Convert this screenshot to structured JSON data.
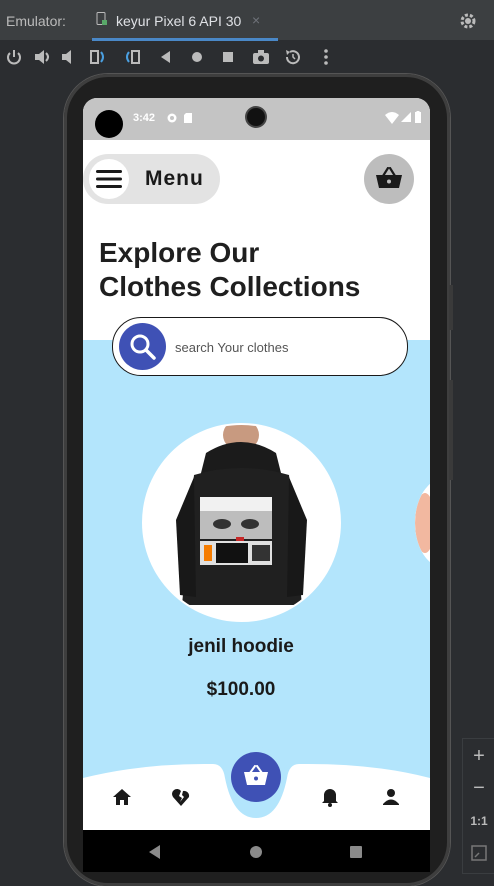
{
  "emulator": {
    "title": "Emulator:",
    "tab_label": "keyur Pixel 6 API 30",
    "tab_close": "×",
    "zoom": {
      "plus": "+",
      "minus": "−",
      "one_to_one": "1:1"
    }
  },
  "status_bar": {
    "time": "3:42"
  },
  "app": {
    "menu_label": "Menu",
    "headline_line1": "Explore Our",
    "headline_line2": "Clothes Collections",
    "search_placeholder": "search Your clothes",
    "product": {
      "name": "jenil hoodie",
      "price": "$100.00"
    },
    "colors": {
      "accent": "#3f51b5",
      "background_blue": "#b3e5fc"
    }
  },
  "icons": [
    "gear-icon",
    "power-icon",
    "volume-up-icon",
    "volume-down-icon",
    "rotate-left-icon",
    "rotate-right-icon",
    "back-icon",
    "home-icon",
    "overview-icon",
    "camera-icon",
    "snapshot-icon",
    "more-icon",
    "hamburger-icon",
    "basket-icon",
    "search-icon",
    "home-nav-icon",
    "broken-heart-icon",
    "notification-icon",
    "person-icon"
  ]
}
